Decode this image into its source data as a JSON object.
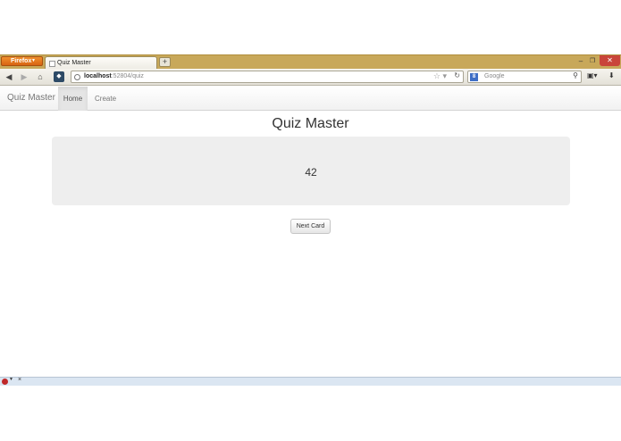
{
  "browser": {
    "menu_button": "Firefox",
    "tab_title": "Quiz Master",
    "new_tab": "+",
    "url_host": "localhost",
    "url_rest": ":52804/quiz",
    "search_placeholder": "Google",
    "search_engine_letter": "8",
    "minimize": "–",
    "maximize": "❐",
    "close": "✕"
  },
  "site": {
    "brand": "Quiz Master",
    "nav": [
      {
        "label": "Home"
      },
      {
        "label": "Create"
      }
    ]
  },
  "main": {
    "title": "Quiz Master",
    "card_value": "42",
    "next_button": "Next Card"
  },
  "addon_bar": {
    "close": "×"
  }
}
